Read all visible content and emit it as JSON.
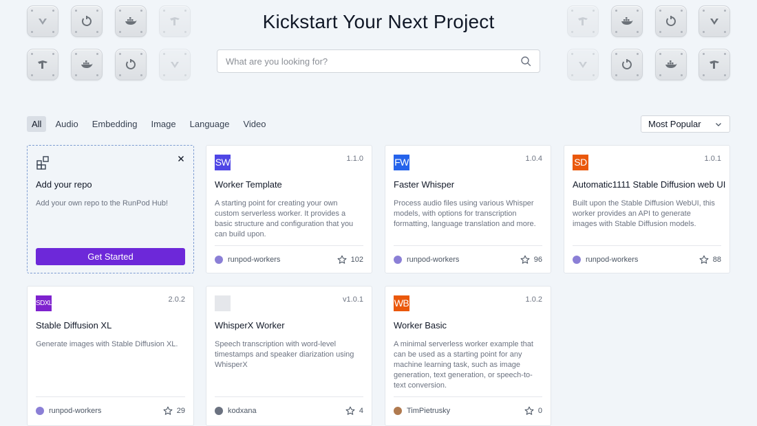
{
  "hero": {
    "title": "Kickstart Your Next Project",
    "search_placeholder": "What are you looking for?"
  },
  "filters": {
    "active": "All",
    "items": [
      "All",
      "Audio",
      "Embedding",
      "Image",
      "Language",
      "Video"
    ]
  },
  "sort": {
    "selected": "Most Popular"
  },
  "add_repo": {
    "title": "Add your repo",
    "description": "Add your own repo to the RunPod Hub!",
    "button_label": "Get Started"
  },
  "cards": [
    {
      "logo_text": "SW",
      "logo_color": "#4f46e5",
      "version": "1.1.0",
      "title": "Worker Template",
      "description": "A starting point for creating your own custom serverless worker. It provides a basic structure and configuration that you can build upon.",
      "author": "runpod-workers",
      "stars": "102",
      "avatar_color": "#8b7fd6"
    },
    {
      "logo_text": "FW",
      "logo_color": "#2563eb",
      "version": "1.0.4",
      "title": "Faster Whisper",
      "description": "Process audio files using various Whisper models, with options for transcription formatting, language translation and more.",
      "author": "runpod-workers",
      "stars": "96",
      "avatar_color": "#8b7fd6"
    },
    {
      "logo_text": "SD",
      "logo_color": "#ea580c",
      "version": "1.0.1",
      "title": "Automatic1111 Stable Diffusion web UI",
      "description": "Built upon the Stable Diffusion WebUI, this worker provides an API to generate images with Stable Diffusion models.",
      "author": "runpod-workers",
      "stars": "88",
      "avatar_color": "#8b7fd6"
    },
    {
      "logo_text": "SDXL",
      "logo_color": "#7e22ce",
      "version": "2.0.2",
      "title": "Stable Diffusion XL",
      "description": "Generate images with Stable Diffusion XL.",
      "author": "runpod-workers",
      "stars": "29",
      "avatar_color": "#8b7fd6"
    },
    {
      "logo_text": "",
      "logo_color": "#e5e7eb",
      "version": "v1.0.1",
      "title": "WhisperX Worker",
      "description": "Speech transcription with word-level timestamps and speaker diarization using WhisperX",
      "author": "kodxana",
      "stars": "4",
      "avatar_color": "#6b7280"
    },
    {
      "logo_text": "WB",
      "logo_color": "#ea580c",
      "version": "1.0.2",
      "title": "Worker Basic",
      "description": "A minimal serverless worker example that can be used as a starting point for any machine learning task, such as image generation, text generation, or speech-to-text conversion.",
      "author": "TimPietrusky",
      "stars": "0",
      "avatar_color": "#b07a4f"
    }
  ],
  "tile_icons": [
    "vue-icon",
    "spinner-icon",
    "docker-icon",
    "tech-icon"
  ]
}
